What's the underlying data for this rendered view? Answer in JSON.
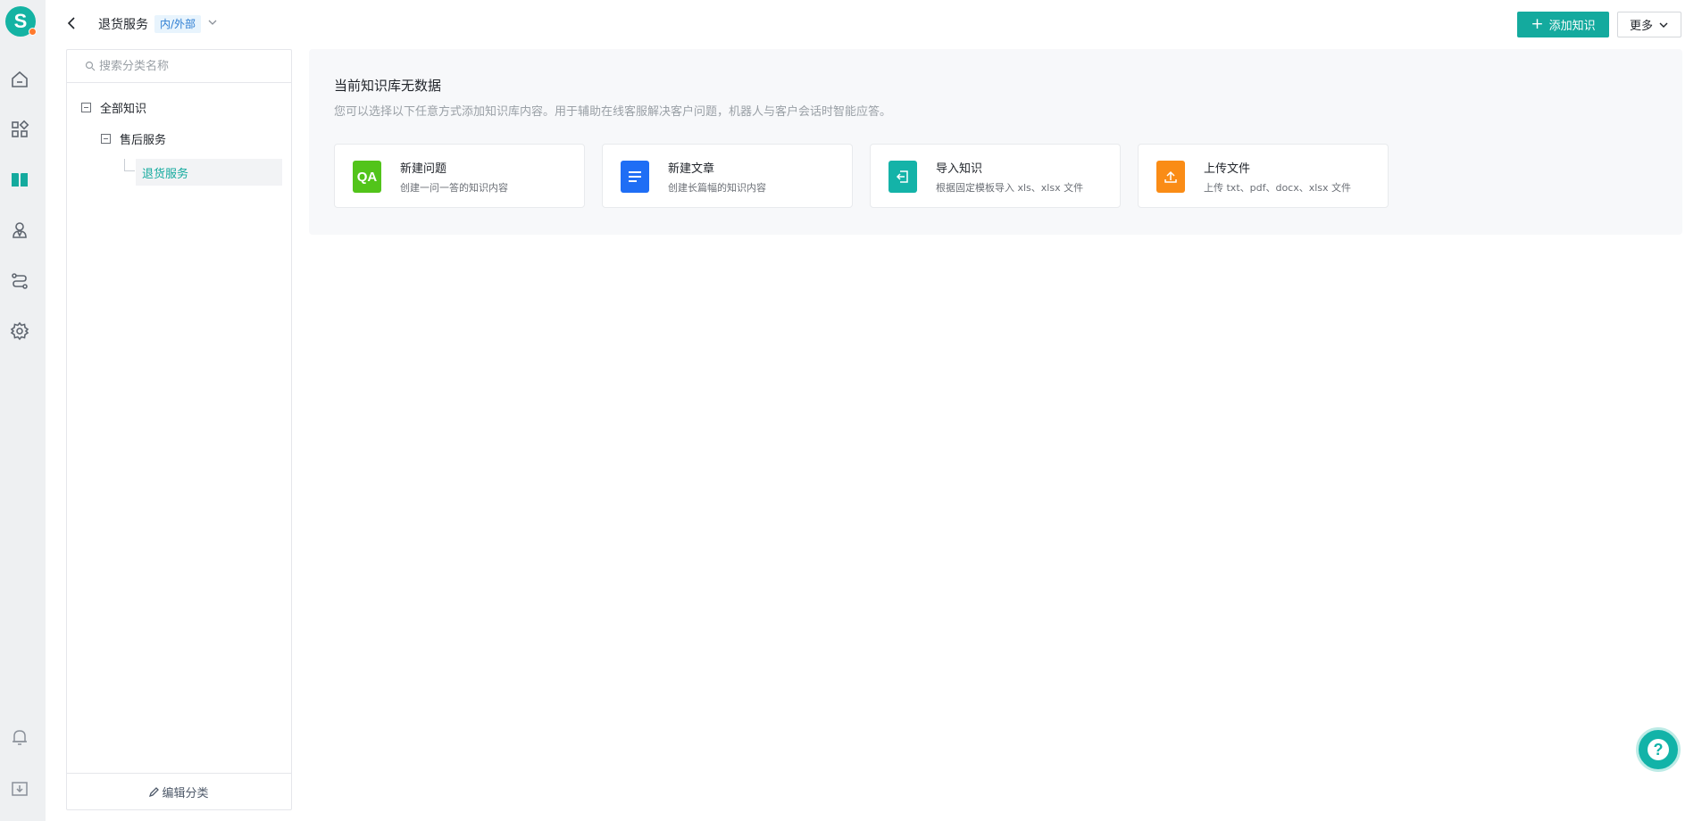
{
  "rail": {
    "logo_letter": "S",
    "icons": [
      "home-icon",
      "apps-grid-icon",
      "knowledge-book-icon",
      "agent-icon",
      "flow-icon",
      "settings-gear-icon",
      "bell-icon",
      "download-box-icon"
    ]
  },
  "header": {
    "title": "退货服务",
    "scope_tag": "内/外部",
    "add_button": "添加知识",
    "more_button": "更多"
  },
  "categories": {
    "search_placeholder": "搜索分类名称",
    "tree": [
      {
        "label": "全部知识",
        "level": 0,
        "expanded": true
      },
      {
        "label": "售后服务",
        "level": 1,
        "expanded": true
      },
      {
        "label": "退货服务",
        "level": 2,
        "selected": true
      }
    ],
    "edit_label": "编辑分类"
  },
  "empty_state": {
    "title": "当前知识库无数据",
    "description": "您可以选择以下任意方式添加知识库内容。用于辅助在线客服解决客户问题，机器人与客户会话时智能应答。",
    "options": [
      {
        "title": "新建问题",
        "desc": "创建一问一答的知识内容",
        "icon": "qa-icon",
        "icon_text": "QA",
        "color": "#52c41a"
      },
      {
        "title": "新建文章",
        "desc": "创建长篇幅的知识内容",
        "icon": "article-icon",
        "color": "#1f6ef5"
      },
      {
        "title": "导入知识",
        "desc": "根据固定模板导入 xls、xlsx 文件",
        "icon": "import-icon",
        "color": "#14b3a8"
      },
      {
        "title": "上传文件",
        "desc": "上传 txt、pdf、docx、xlsx 文件",
        "icon": "upload-icon",
        "color": "#fa8c16"
      }
    ]
  },
  "colors": {
    "accent": "#14aa9e",
    "rail_bg": "#eef0f2"
  }
}
